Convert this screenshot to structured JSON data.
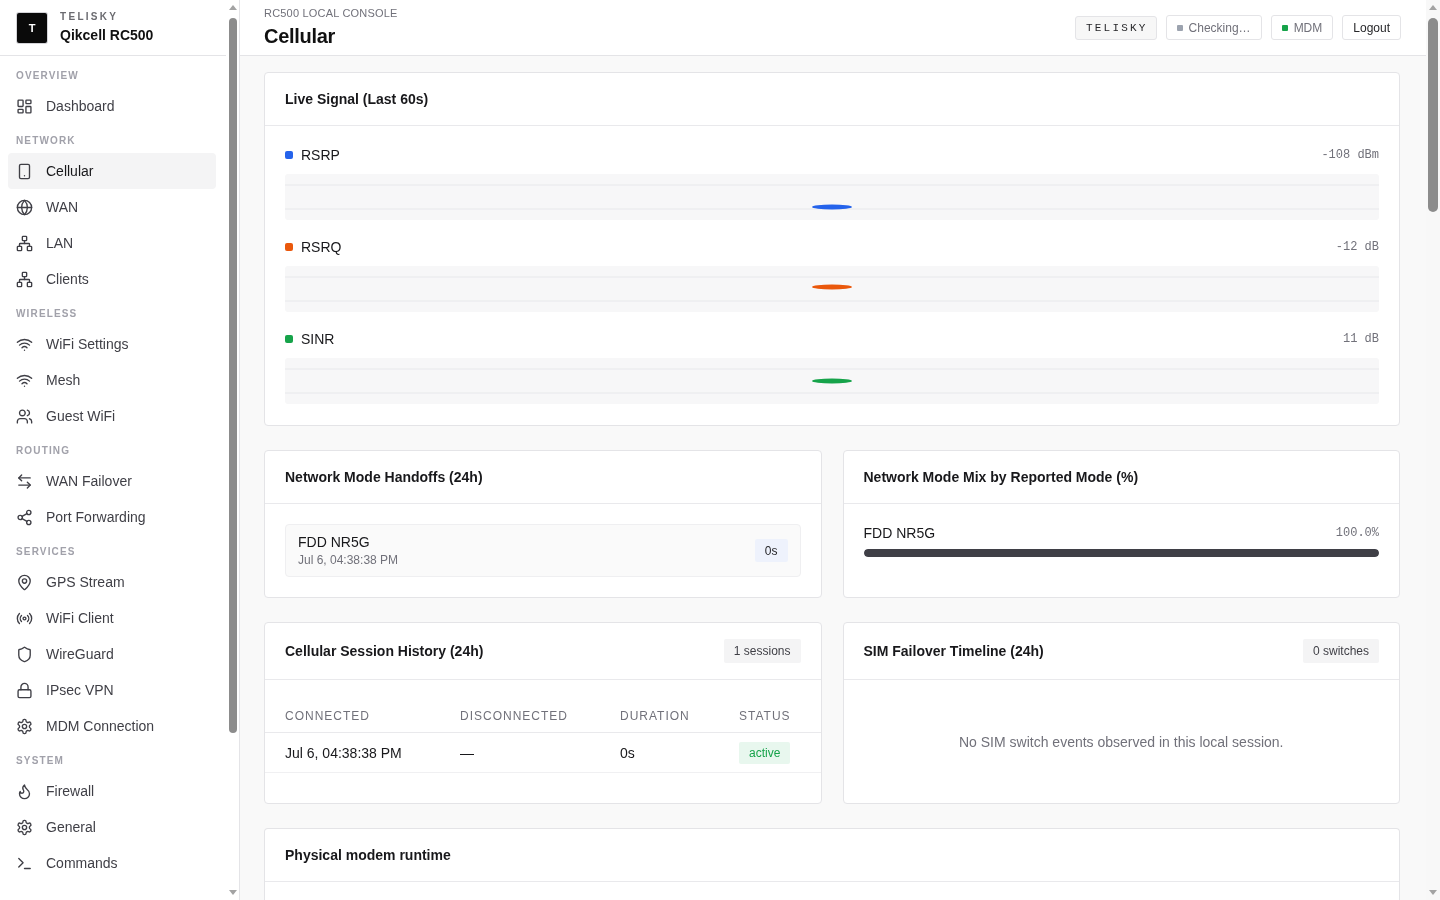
{
  "sidebar": {
    "brand": {
      "logo": "T",
      "name": "TELISKY",
      "product": "Qikcell RC500"
    },
    "sections": [
      {
        "label": "OVERVIEW",
        "items": [
          {
            "label": "Dashboard",
            "selected": false
          }
        ]
      },
      {
        "label": "NETWORK",
        "items": [
          {
            "label": "Cellular",
            "selected": true
          },
          {
            "label": "WAN",
            "selected": false
          },
          {
            "label": "LAN",
            "selected": false
          },
          {
            "label": "Clients",
            "selected": false
          }
        ]
      },
      {
        "label": "WIRELESS",
        "items": [
          {
            "label": "WiFi Settings",
            "selected": false
          },
          {
            "label": "Mesh",
            "selected": false
          },
          {
            "label": "Guest WiFi",
            "selected": false
          }
        ]
      },
      {
        "label": "ROUTING",
        "items": [
          {
            "label": "WAN Failover",
            "selected": false
          },
          {
            "label": "Port Forwarding",
            "selected": false
          }
        ]
      },
      {
        "label": "SERVICES",
        "items": [
          {
            "label": "GPS Stream",
            "selected": false
          },
          {
            "label": "WiFi Client",
            "selected": false
          },
          {
            "label": "WireGuard",
            "selected": false
          },
          {
            "label": "IPsec VPN",
            "selected": false
          },
          {
            "label": "MDM Connection",
            "selected": false
          }
        ]
      },
      {
        "label": "SYSTEM",
        "items": [
          {
            "label": "Firewall",
            "selected": false
          },
          {
            "label": "General",
            "selected": false
          },
          {
            "label": "Commands",
            "selected": false
          }
        ]
      }
    ]
  },
  "header": {
    "eyebrow": "RC500 LOCAL CONSOLE",
    "title": "Cellular",
    "chips": [
      {
        "kind": "brand",
        "label": "TELISKY"
      },
      {
        "kind": "status",
        "label": "Checking…",
        "color": "#9ca3af"
      },
      {
        "kind": "status",
        "label": "MDM",
        "color": "#16a34a"
      }
    ],
    "logout_button": "Logout"
  },
  "live_signal": {
    "title": "Live Signal (Last 60s)",
    "series": [
      {
        "name": "RSRP",
        "color": "#2563eb",
        "reading": "-108 dBm"
      },
      {
        "name": "RSRQ",
        "color": "#ea580c",
        "reading": "-12 dB"
      },
      {
        "name": "SINR",
        "color": "#16a34a",
        "reading": "11 dB"
      }
    ]
  },
  "handoffs": {
    "title": "Network Mode Handoffs (24h)",
    "items": [
      {
        "mode": "FDD NR5G",
        "time": "Jul 6, 04:38:38 PM",
        "duration": "0s"
      }
    ]
  },
  "mode_mix": {
    "title": "Network Mode Mix by Reported Mode (%)",
    "items": [
      {
        "mode": "FDD NR5G",
        "value": "100.0%",
        "level": 1
      }
    ]
  },
  "sessions": {
    "title": "Cellular Session History (24h)",
    "badge": "1 sessions",
    "columns": [
      "CONNECTED",
      "DISCONNECTED",
      "DURATION",
      "STATUS"
    ],
    "rows": [
      {
        "connected": "Jul 6, 04:38:38 PM",
        "disconnected": "—",
        "duration": "0s",
        "status": "active"
      }
    ]
  },
  "sim_failover": {
    "title": "SIM Failover Timeline (24h)",
    "badge": "0 switches",
    "empty_message": "No SIM switch events observed in this local session."
  },
  "modem_runtime": {
    "title": "Physical modem runtime"
  }
}
